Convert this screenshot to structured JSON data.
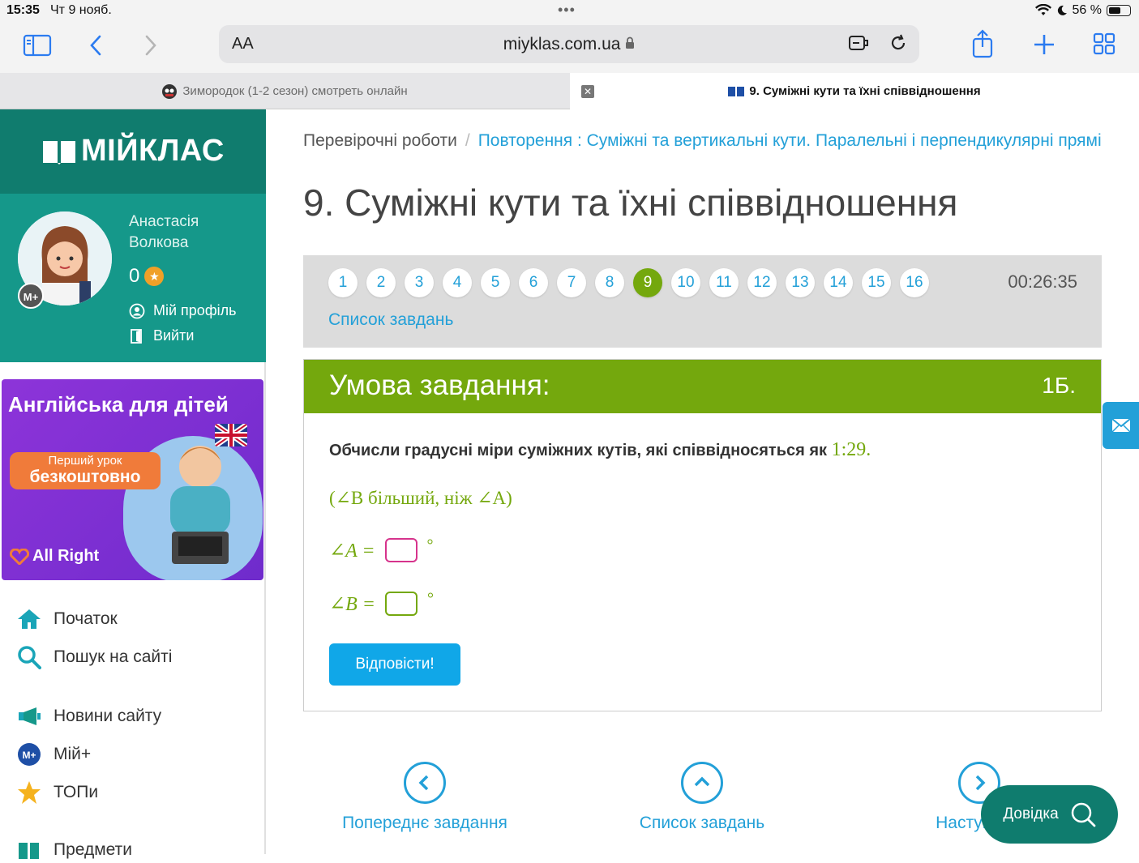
{
  "status_bar": {
    "time": "15:35",
    "date": "Чт 9 нояб.",
    "battery": "56 %"
  },
  "browser": {
    "aa_label": "AA",
    "url": "miyklas.com.ua",
    "tabs": [
      {
        "title": "Зимородок (1-2 сезон) смотреть онлайн"
      },
      {
        "title": "9. Суміжні кути та їхні співвідношення"
      }
    ]
  },
  "sidebar": {
    "logo_text": "МІЙКЛАС",
    "user": {
      "name": "Анастасія Волкова",
      "points": "0",
      "badge": "M+"
    },
    "profile_links": [
      {
        "label": "Мій профіль",
        "icon": "user-circle-icon"
      },
      {
        "label": "Вийти",
        "icon": "logout-door-icon"
      }
    ],
    "ad": {
      "title": "Англійська для дітей",
      "pill_line1": "Перший урок",
      "pill_line2": "безкоштовно",
      "brand": "All Right"
    },
    "nav": [
      {
        "label": "Початок",
        "icon": "home-icon"
      },
      {
        "label": "Пошук на сайті",
        "icon": "search-icon"
      },
      {
        "label": "Новини сайту",
        "icon": "megaphone-icon"
      },
      {
        "label": "Мій+",
        "icon": "mplus-icon"
      },
      {
        "label": "ТОПи",
        "icon": "star-icon"
      },
      {
        "label": "Предмети",
        "icon": "book-icon"
      }
    ]
  },
  "main": {
    "breadcrumb": {
      "root": "Перевірочні роботи",
      "separator": "/",
      "current": "Повторення : Суміжні та вертикальні кути. Паралельні і перпендикулярні прямі"
    },
    "title": "9. Суміжні кути та їхні співвідношення",
    "task_numbers": [
      "1",
      "2",
      "3",
      "4",
      "5",
      "6",
      "7",
      "8",
      "9",
      "10",
      "11",
      "12",
      "13",
      "14",
      "15",
      "16"
    ],
    "active_task": "9",
    "timer": "00:26:35",
    "task_list_label": "Список завдань",
    "card": {
      "header": "Умова завдання:",
      "points": "1Б.",
      "question": "Обчисли градусні міри суміжних кутів, які співвідносяться як",
      "ratio": "1:29.",
      "condition": "(∠B  більший,  ніж ∠A)",
      "eq_a": "∠A =",
      "eq_b": "∠B =",
      "degree": "°",
      "submit": "Відповісти!"
    },
    "bottom_nav": {
      "prev": "Попереднє завдання",
      "list": "Список завдань",
      "next": "Наступне з"
    },
    "help_label": "Довідка"
  },
  "colors": {
    "teal_dark": "#107c6e",
    "teal": "#15988a",
    "green": "#74a80d",
    "blue_link": "#23a0d8",
    "button_blue": "#10a7e8"
  }
}
